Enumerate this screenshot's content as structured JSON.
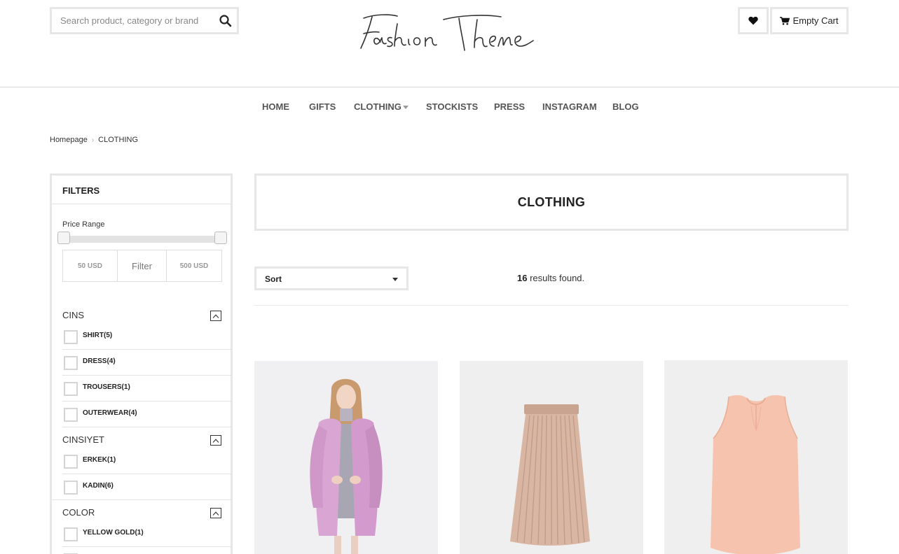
{
  "header": {
    "search": {
      "placeholder": "Search product, category or brand",
      "value": ""
    },
    "logo_text": "Fashion Theme",
    "cart_label": "Empty Cart"
  },
  "nav": {
    "items": [
      {
        "label": "HOME"
      },
      {
        "label": "GIFTS"
      },
      {
        "label": "CLOTHING",
        "has_dropdown": true
      },
      {
        "label": "STOCKISTS"
      },
      {
        "label": "PRESS"
      },
      {
        "label": "INSTAGRAM"
      },
      {
        "label": "BLOG"
      }
    ]
  },
  "breadcrumb": {
    "items": [
      "Homepage",
      "CLOTHING"
    ]
  },
  "filters": {
    "title": "FILTERS",
    "price": {
      "label": "Price Range",
      "min": "50 USD",
      "button": "Filter",
      "max": "500 USD"
    },
    "groups": [
      {
        "title": "CINS",
        "options": [
          "SHIRT(5)",
          "DRESS(4)",
          "TROUSERS(1)",
          "OUTERWEAR(4)"
        ]
      },
      {
        "title": "CINSIYET",
        "options": [
          "ERKEK(1)",
          "KADIN(6)"
        ]
      },
      {
        "title": "COLOR",
        "options": [
          "YELLOW GOLD(1)"
        ]
      }
    ]
  },
  "main": {
    "title": "CLOTHING",
    "sort_label": "Sort",
    "results_count": "16",
    "results_text": "results found."
  },
  "products": [
    {
      "image": "pink-coat-model"
    },
    {
      "image": "pleated-skirt"
    },
    {
      "image": "peach-sleeveless-top"
    }
  ],
  "colors": {
    "border": "#e7e7e7",
    "text": "#333333",
    "nav_text": "#555555"
  }
}
